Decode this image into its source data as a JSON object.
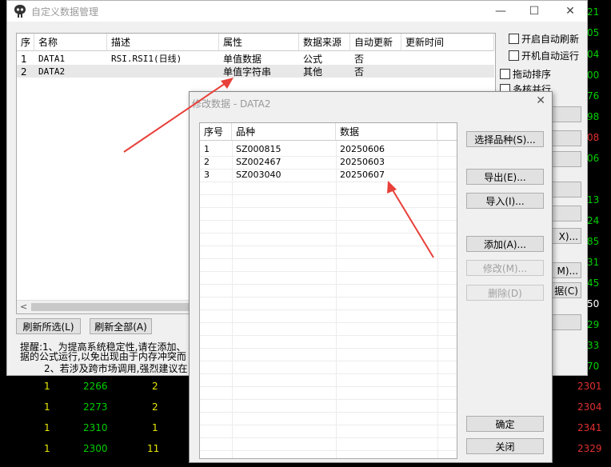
{
  "background": {
    "right_numbers": [
      {
        "text": "21",
        "color": "green"
      },
      {
        "text": "05",
        "color": "green"
      },
      {
        "text": "04",
        "color": "green"
      },
      {
        "text": "00",
        "color": "green"
      },
      {
        "text": "76",
        "color": "green"
      },
      {
        "text": "98",
        "color": "green"
      },
      {
        "text": "08",
        "color": "red"
      },
      {
        "text": "06",
        "color": "green"
      },
      {
        "text": "",
        "color": "green"
      },
      {
        "text": "13",
        "color": "green"
      },
      {
        "text": "24",
        "color": "green"
      },
      {
        "text": "85",
        "color": "green"
      },
      {
        "text": "31",
        "color": "green"
      },
      {
        "text": "45",
        "color": "green"
      },
      {
        "text": "50",
        "color": "white"
      },
      {
        "text": "29",
        "color": "green"
      },
      {
        "text": "33",
        "color": "green"
      },
      {
        "text": "70",
        "color": "green"
      }
    ],
    "rows": [
      {
        "c1": "1",
        "c2": "2266",
        "c3": "2",
        "c4": "2301"
      },
      {
        "c1": "1",
        "c2": "2273",
        "c3": "2",
        "c4": "2304"
      },
      {
        "c1": "1",
        "c2": "2310",
        "c3": "1",
        "c4": "2341"
      },
      {
        "c1": "1",
        "c2": "2300",
        "c3": "11",
        "c4": "2329"
      }
    ]
  },
  "main_window": {
    "title": "自定义数据管理",
    "columns": [
      "序",
      "名称",
      "描述",
      "属性",
      "数据来源",
      "自动更新",
      "更新时间"
    ],
    "rows": [
      {
        "seq": "1",
        "name": "DATA1",
        "desc": "RSI.RSI1(日线)",
        "attr": "单值数据",
        "source": "公式",
        "auto": "否",
        "time": ""
      },
      {
        "seq": "2",
        "name": "DATA2",
        "desc": "",
        "attr": "单值字符串",
        "source": "其他",
        "auto": "否",
        "time": ""
      }
    ],
    "checkboxes": [
      {
        "label": "开启自动刷新"
      },
      {
        "label": "开机自动运行"
      },
      {
        "label": "拖动排序"
      },
      {
        "label": "多核并行"
      }
    ],
    "buttons": {
      "refresh_selected": "刷新所选(L)",
      "refresh_all": "刷新全部(A)"
    },
    "right_button_fragments": [
      "X)...",
      "M)...",
      "据(C)"
    ],
    "notes": {
      "line1": "提醒:1、为提高系统稳定性,请在添加、",
      "line2": "据的公式运行,以免出现由于内存冲突而",
      "line3": "2、若涉及跨市场调用,强烈建议在"
    }
  },
  "dialog": {
    "title": "修改数据 - DATA2",
    "columns": [
      "序号",
      "品种",
      "数据"
    ],
    "rows": [
      {
        "seq": "1",
        "code": "SZ000815",
        "data": "20250606"
      },
      {
        "seq": "2",
        "code": "SZ002467",
        "data": "20250603"
      },
      {
        "seq": "3",
        "code": "SZ003040",
        "data": "20250607"
      }
    ],
    "buttons": {
      "select": "选择品种(S)...",
      "export": "导出(E)...",
      "import": "导入(I)...",
      "add": "添加(A)...",
      "modify": "修改(M)...",
      "delete": "删除(D)",
      "ok": "确定",
      "close": "关闭"
    }
  },
  "colors": {
    "arrow": "#e8403a",
    "bg_green": "#00d000",
    "bg_red": "#e03030",
    "bg_yellow": "#e8e800"
  }
}
